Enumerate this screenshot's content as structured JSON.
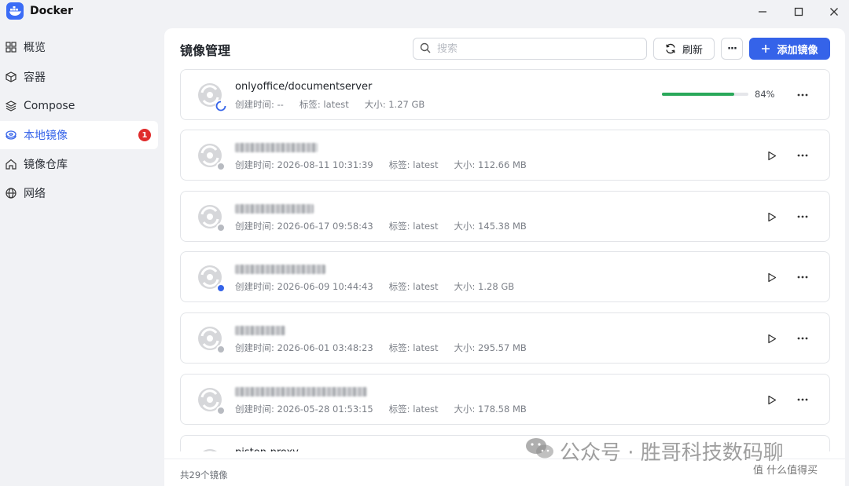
{
  "window": {
    "title": "Docker"
  },
  "sidebar": {
    "items": [
      {
        "label": "概览",
        "icon": "grid-icon"
      },
      {
        "label": "容器",
        "icon": "cube-icon"
      },
      {
        "label": "Compose",
        "icon": "layers-icon"
      },
      {
        "label": "本地镜像",
        "icon": "disc-icon",
        "badge": "1",
        "active": true
      },
      {
        "label": "镜像仓库",
        "icon": "home-icon"
      },
      {
        "label": "网络",
        "icon": "globe-icon"
      }
    ]
  },
  "header": {
    "title": "镜像管理",
    "search_placeholder": "搜索",
    "refresh_label": "刷新",
    "more_label": "···",
    "add_label": "添加镜像"
  },
  "images": [
    {
      "name": "onlyoffice/documentserver",
      "created_label": "创建时间: --",
      "tag_label": "标签: latest",
      "size_label": "大小: 1.27 GB",
      "progress": 84,
      "progress_text": "84%",
      "status": "loading"
    },
    {
      "name": "",
      "created_label": "创建时间: 2026-08-11 10:31:39",
      "tag_label": "标签: latest",
      "size_label": "大小: 112.66 MB",
      "status": "stopped"
    },
    {
      "name": "",
      "created_label": "创建时间: 2026-06-17 09:58:43",
      "tag_label": "标签: latest",
      "size_label": "大小: 145.38 MB",
      "status": "stopped"
    },
    {
      "name": "",
      "created_label": "创建时间: 2026-06-09 10:44:43",
      "tag_label": "标签: latest",
      "size_label": "大小: 1.28 GB",
      "status": "running"
    },
    {
      "name": "",
      "created_label": "创建时间: 2026-06-01 03:48:23",
      "tag_label": "标签: latest",
      "size_label": "大小: 295.57 MB",
      "status": "stopped"
    },
    {
      "name": "",
      "created_label": "创建时间: 2026-05-28 01:53:15",
      "tag_label": "标签: latest",
      "size_label": "大小: 178.58 MB",
      "status": "stopped"
    },
    {
      "name": "piston-proxy"
    }
  ],
  "footer": {
    "total_label": "共29个镜像"
  },
  "watermark": {
    "text": "公众号 · 胜哥科技数码聊",
    "sub": "值 什么值得买"
  },
  "colors": {
    "accent": "#3563e9",
    "progress": "#2aa85a",
    "badge": "#e02b2b",
    "running": "#3563e9",
    "stopped": "#b8bbc1"
  }
}
